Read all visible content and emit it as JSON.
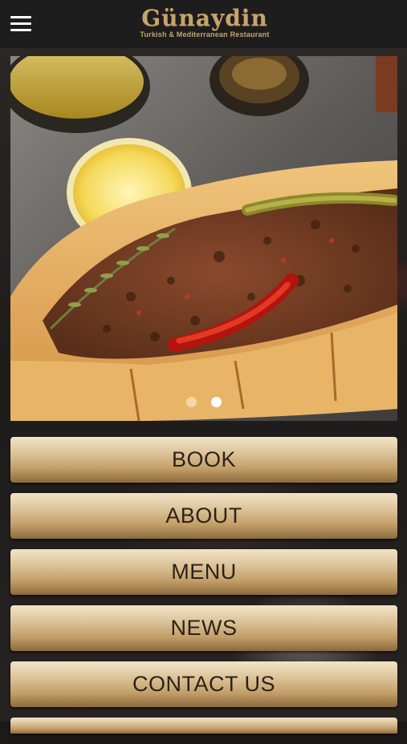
{
  "header": {
    "menu_icon": "hamburger-icon",
    "logo_title": "Günaydin",
    "logo_subtitle": "Turkish & Mediterranean Restaurant"
  },
  "carousel": {
    "total_slides": 2,
    "active_slide": 2
  },
  "menu": {
    "items": [
      {
        "label": "BOOK"
      },
      {
        "label": "ABOUT"
      },
      {
        "label": "MENU"
      },
      {
        "label": "NEWS"
      },
      {
        "label": "CONTACT US"
      }
    ]
  },
  "colors": {
    "header_bg": "#1d1d1d",
    "logo_gold": "#c6a46e",
    "button_text": "#2d2218"
  }
}
